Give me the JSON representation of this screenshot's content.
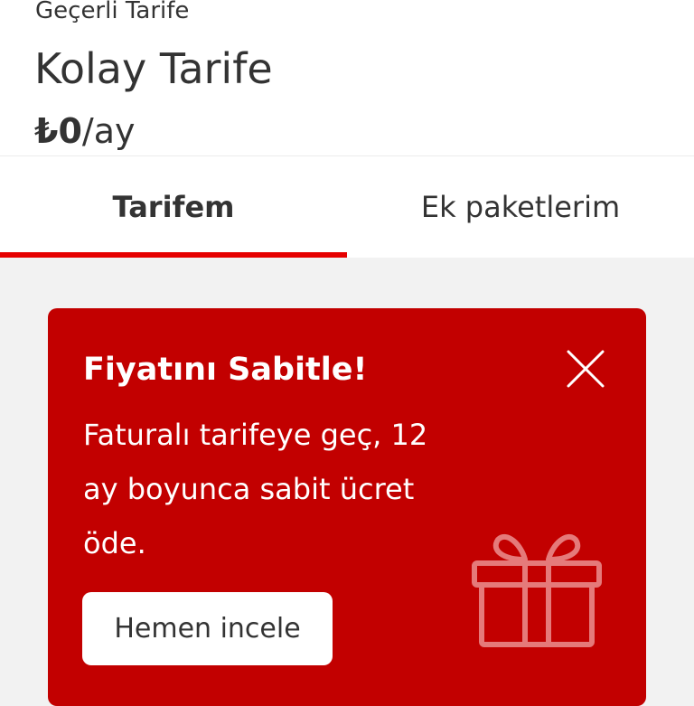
{
  "header": {
    "current_plan_label": "Geçerli Tarife",
    "plan_name": "Kolay Tarife",
    "price_amount": "₺0",
    "price_period": "/ay"
  },
  "tabs": [
    {
      "label": "Tarifem",
      "active": true
    },
    {
      "label": "Ek paketlerim",
      "active": false
    }
  ],
  "promo": {
    "title": "Fiyatını Sabitle!",
    "body": "Faturalı tarifeye geç, 12 ay boyunca sabit ücret öde.",
    "cta_label": "Hemen incele",
    "close_icon": "close-icon",
    "gift_icon": "gift-icon"
  },
  "colors": {
    "accent": "#e60000",
    "promo_background": "#c20000",
    "page_background": "#f2f2f2",
    "text": "#333333"
  }
}
